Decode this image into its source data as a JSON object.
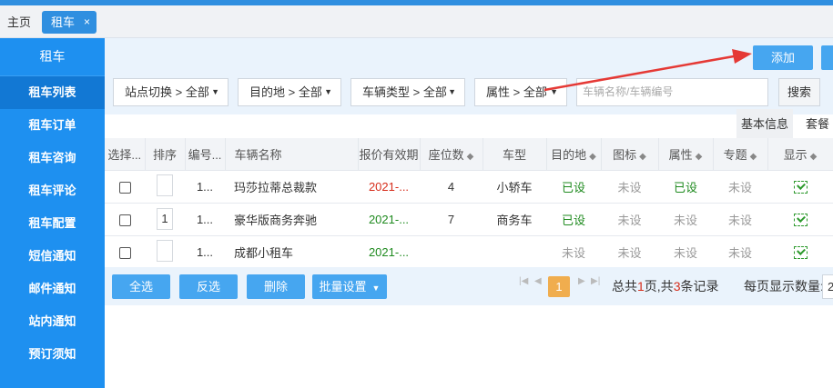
{
  "tabs": {
    "home": "主页",
    "active": "租车",
    "close": "×"
  },
  "sidebar": {
    "title": "租车",
    "items": [
      {
        "label": "租车列表"
      },
      {
        "label": "租车订单"
      },
      {
        "label": "租车咨询"
      },
      {
        "label": "租车评论"
      },
      {
        "label": "租车配置"
      },
      {
        "label": "短信通知"
      },
      {
        "label": "邮件通知"
      },
      {
        "label": "站内通知"
      },
      {
        "label": "预订须知"
      }
    ]
  },
  "actions": {
    "add": "添加"
  },
  "filters": {
    "station": "站点切换 > 全部",
    "destination": "目的地 > 全部",
    "vehicle_type": "车辆类型 > 全部",
    "attribute": "属性 > 全部",
    "search_placeholder": "车辆名称/车辆编号",
    "search_button": "搜索"
  },
  "info_tabs": {
    "basic": "基本信息",
    "package": "套餐"
  },
  "table": {
    "headers": {
      "select": "选择...",
      "order": "排序",
      "number": "编号...",
      "name": "车辆名称",
      "price_valid": "报价有效期",
      "seats": "座位数",
      "model": "车型",
      "destination": "目的地",
      "icon": "图标",
      "attribute": "属性",
      "topic": "专题",
      "display": "显示"
    },
    "rows": [
      {
        "order": "",
        "number": "1...",
        "name": "玛莎拉蒂总裁款",
        "price_valid": "2021-...",
        "price_color": "red",
        "seats": "4",
        "model": "小轿车",
        "destination": "已设",
        "icon": "未设",
        "attribute": "已设",
        "topic": "未设"
      },
      {
        "order": "1",
        "number": "1...",
        "name": "豪华版商务奔驰",
        "price_valid": "2021-...",
        "price_color": "green",
        "seats": "7",
        "model": "商务车",
        "destination": "已设",
        "icon": "未设",
        "attribute": "未设",
        "topic": "未设"
      },
      {
        "order": "",
        "number": "1...",
        "name": "成都小租车",
        "price_valid": "2021-...",
        "price_color": "green",
        "seats": "",
        "model": "",
        "destination": "未设",
        "icon": "未设",
        "attribute": "未设",
        "topic": "未设"
      }
    ]
  },
  "bottom": {
    "select_all": "全选",
    "invert": "反选",
    "delete": "删除",
    "batch": "批量设置",
    "current_page": "1",
    "info_prefix": "总共",
    "total_pages": "1",
    "info_mid": "页,共",
    "total_records": "3",
    "info_suffix": "条记录",
    "page_size_label": "每页显示数量:",
    "page_size_value": "2"
  },
  "colors": {
    "accent": "#2f8fe0",
    "sidebar": "#1e90f0",
    "button": "#46a6f0",
    "arrow": "#e53935"
  }
}
